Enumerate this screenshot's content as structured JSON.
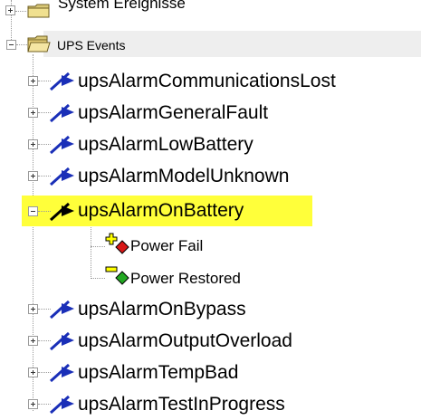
{
  "tree": {
    "nodes": [
      {
        "label": "System Ereignisse",
        "icon": "folder-icon",
        "expanded": false
      },
      {
        "label": "UPS Events",
        "icon": "folder-open-icon",
        "expanded": true,
        "selected": true
      }
    ],
    "events": [
      {
        "label": "upsAlarmCommunicationsLost",
        "icon": "trap-arrow-icon",
        "expanded": false
      },
      {
        "label": "upsAlarmGeneralFault",
        "icon": "trap-arrow-icon",
        "expanded": false
      },
      {
        "label": "upsAlarmLowBattery",
        "icon": "trap-arrow-icon",
        "expanded": false
      },
      {
        "label": "upsAlarmModelUnknown",
        "icon": "trap-arrow-icon",
        "expanded": false
      },
      {
        "label": "upsAlarmOnBattery",
        "icon": "trap-arrow-icon",
        "expanded": true,
        "highlight": "#ffff3a"
      },
      {
        "label": "upsAlarmOnBypass",
        "icon": "trap-arrow-icon",
        "expanded": false
      },
      {
        "label": "upsAlarmOutputOverload",
        "icon": "trap-arrow-icon",
        "expanded": false
      },
      {
        "label": "upsAlarmTempBad",
        "icon": "trap-arrow-icon",
        "expanded": false
      },
      {
        "label": "upsAlarmTestInProgress",
        "icon": "trap-arrow-icon",
        "expanded": false
      }
    ],
    "actions": [
      {
        "label": "Power Fail",
        "icon": "power-fail-icon",
        "color": "#d81818"
      },
      {
        "label": "Power Restored",
        "icon": "power-restored-icon",
        "color": "#22a822"
      }
    ]
  }
}
